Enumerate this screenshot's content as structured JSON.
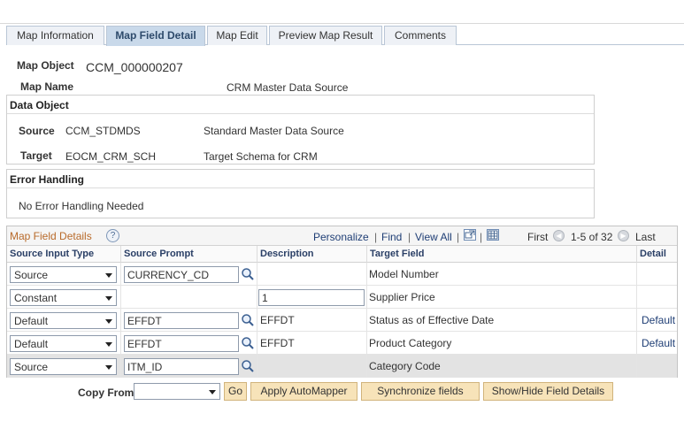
{
  "tabs": [
    {
      "label": "Map Information"
    },
    {
      "label": "Map Field Detail",
      "active": true
    },
    {
      "label": "Map Edit"
    },
    {
      "label": "Preview Map Result"
    },
    {
      "label": "Comments"
    }
  ],
  "header": {
    "map_object_label": "Map Object",
    "map_object_value": "CCM_000000207",
    "map_name_label": "Map Name",
    "map_name_value": "CRM Master Data Source"
  },
  "data_object": {
    "title": "Data Object",
    "source_label": "Source",
    "source_code": "CCM_STDMDS",
    "source_desc": "Standard Master Data Source",
    "target_label": "Target",
    "target_code": "EOCM_CRM_SCH",
    "target_desc": "Target Schema for CRM"
  },
  "error_handling": {
    "title": "Error Handling",
    "text": "No Error Handling Needed"
  },
  "grid": {
    "title": "Map Field Details",
    "help_icon": "?",
    "nav": {
      "personalize": "Personalize",
      "find": "Find",
      "view_all": "View All",
      "separator": "|",
      "first": "First",
      "range": "1-5 of 32",
      "last": "Last"
    },
    "columns": {
      "source_input_type": "Source Input Type",
      "source_prompt": "Source Prompt",
      "description": "Description",
      "target_field": "Target Field",
      "detail": "Detail"
    },
    "rows": [
      {
        "input_type": "Source",
        "prompt": "CURRENCY_CD",
        "description": "",
        "target": "Model Number",
        "detail": ""
      },
      {
        "input_type": "Constant",
        "prompt": "",
        "description": "1",
        "target": "Supplier Price",
        "detail": ""
      },
      {
        "input_type": "Default",
        "prompt": "EFFDT",
        "description": "EFFDT",
        "target": "Status as of Effective Date",
        "detail": "Default"
      },
      {
        "input_type": "Default",
        "prompt": "EFFDT",
        "description": "EFFDT",
        "target": "Product Category",
        "detail": "Default"
      },
      {
        "input_type": "Source",
        "prompt": "ITM_ID",
        "description": "",
        "target": "Category Code",
        "detail": ""
      }
    ]
  },
  "footer": {
    "copy_from_label": "Copy From",
    "copy_from_value": "",
    "go": "Go",
    "apply_automapper": "Apply AutoMapper",
    "synchronize_fields": "Synchronize fields",
    "show_hide": "Show/Hide Field Details"
  },
  "colors": {
    "tab_active": "#c9d9ea",
    "grid_title": "#b86a2a",
    "link": "#1f3e75",
    "button": "#f7e3b9"
  }
}
